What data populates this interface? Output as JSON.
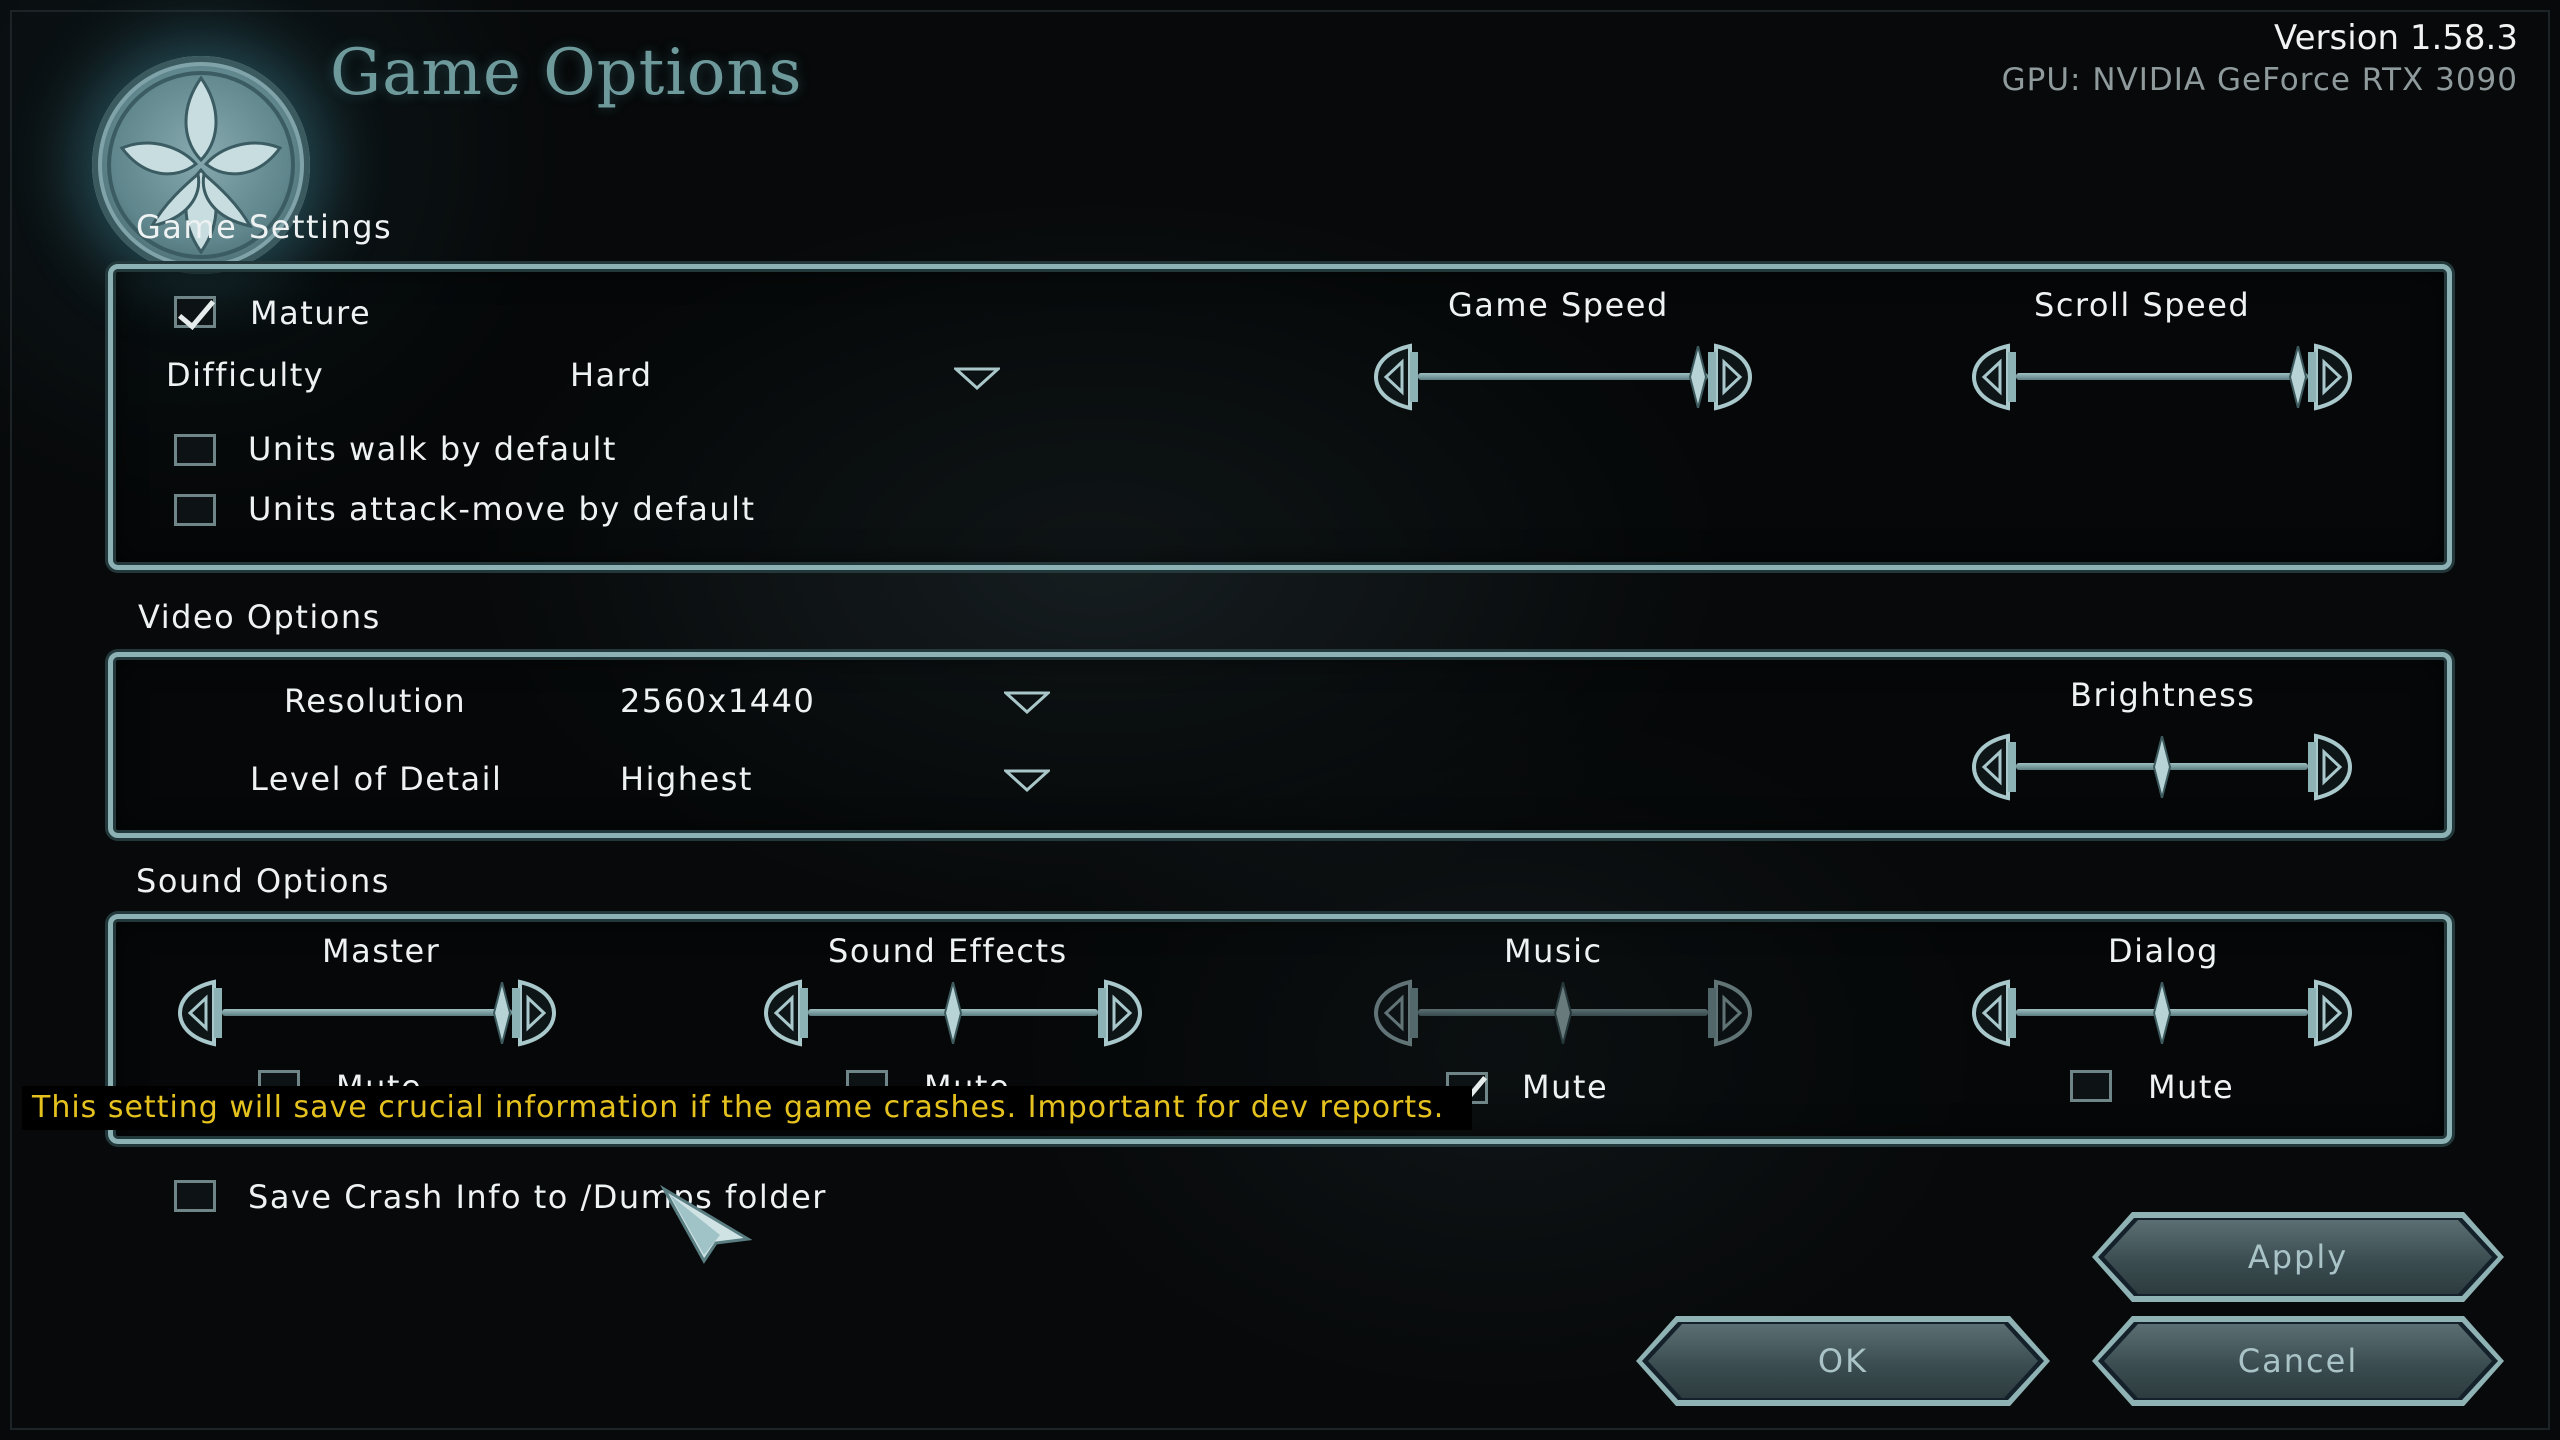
{
  "header": {
    "title": "Game Options",
    "version": "Version 1.58.3",
    "gpu": "GPU: NVIDIA GeForce RTX 3090",
    "logo_icon": "clan-crest-icon"
  },
  "game_settings": {
    "section_label": "Game Settings",
    "mature": {
      "label": "Mature",
      "checked": true
    },
    "difficulty": {
      "label": "Difficulty",
      "value": "Hard"
    },
    "units_walk": {
      "label": "Units walk by default",
      "checked": false
    },
    "units_attack_move": {
      "label": "Units attack-move by default",
      "checked": false
    },
    "game_speed": {
      "label": "Game Speed",
      "level": 1.0
    },
    "scroll_speed": {
      "label": "Scroll Speed",
      "level": 1.0
    }
  },
  "video_options": {
    "section_label": "Video Options",
    "resolution": {
      "label": "Resolution",
      "value": "2560x1440"
    },
    "level_of_detail": {
      "label": "Level of Detail",
      "value": "Highest"
    },
    "brightness": {
      "label": "Brightness",
      "level": 0.5
    }
  },
  "sound_options": {
    "section_label": "Sound Options",
    "master": {
      "label": "Master",
      "level": 1.0,
      "mute_label": "Mute",
      "muted": false
    },
    "sound_effects": {
      "label": "Sound Effects",
      "level": 0.5,
      "mute_label": "Mute",
      "muted": false
    },
    "music": {
      "label": "Music",
      "level": 0.5,
      "mute_label": "Mute",
      "muted": true
    },
    "dialog": {
      "label": "Dialog",
      "level": 0.5,
      "mute_label": "Mute",
      "muted": false
    }
  },
  "crash": {
    "label": "Save Crash Info to /Dumps folder",
    "checked": false,
    "tooltip": "This setting will save crucial information if the game crashes. Important for dev reports."
  },
  "buttons": {
    "apply": "Apply",
    "ok": "OK",
    "cancel": "Cancel"
  },
  "colors": {
    "accent": "#8db2b5",
    "title": "#6f9a9c",
    "tooltip_text": "#e6c21e"
  }
}
